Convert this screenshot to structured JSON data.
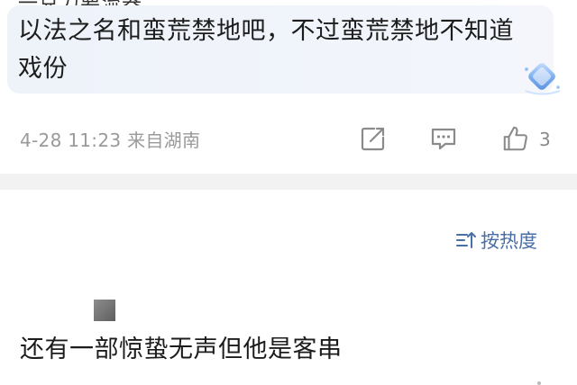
{
  "header": {
    "cut_text": "一克力要流器"
  },
  "comment": {
    "text": "以法之名和蛮荒禁地吧，不过蛮荒禁地不知道戏份",
    "date": "4-28 11:23",
    "location": "来自湖南",
    "like_count": "3"
  },
  "sort": {
    "label": "按热度"
  },
  "comment2": {
    "text": "还有一部惊蛰无声但他是客串"
  },
  "colors": {
    "accent": "#4a6ea6",
    "meta": "#9a9a9a",
    "bubble": "#eef2f9",
    "separator": "#f2f2f2"
  }
}
